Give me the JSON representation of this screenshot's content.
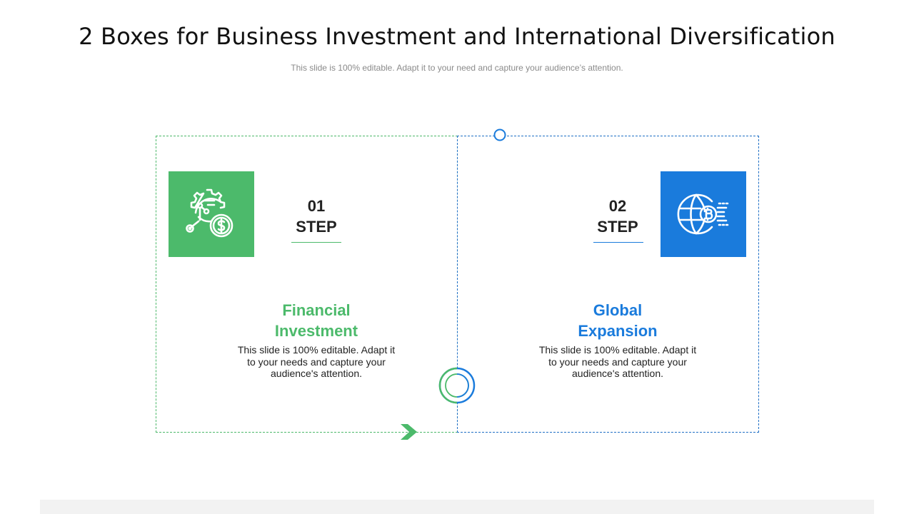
{
  "header": {
    "title": "2 Boxes for Business Investment and International Diversification",
    "subtitle": "This slide is 100% editable. Adapt it to your need and capture your audience’s attention."
  },
  "steps": [
    {
      "number": "01",
      "step_label": "STEP",
      "heading_line1": "Financial",
      "heading_line2": "Investment",
      "desc_line1": "This slide is 100% editable. Adapt it",
      "desc_line2": "to your needs and capture your",
      "desc_line3": "audience's attention.",
      "icon": "investment-gear-dollar-icon",
      "color": "#4cba6b"
    },
    {
      "number": "02",
      "step_label": "STEP",
      "heading_line1": "Global",
      "heading_line2": "Expansion",
      "desc_line1": "This slide is 100% editable. Adapt it",
      "desc_line2": "to your needs and capture your",
      "desc_line3": "audience's attention.",
      "icon": "globe-bitcoin-icon",
      "color": "#1a7bdc"
    }
  ]
}
